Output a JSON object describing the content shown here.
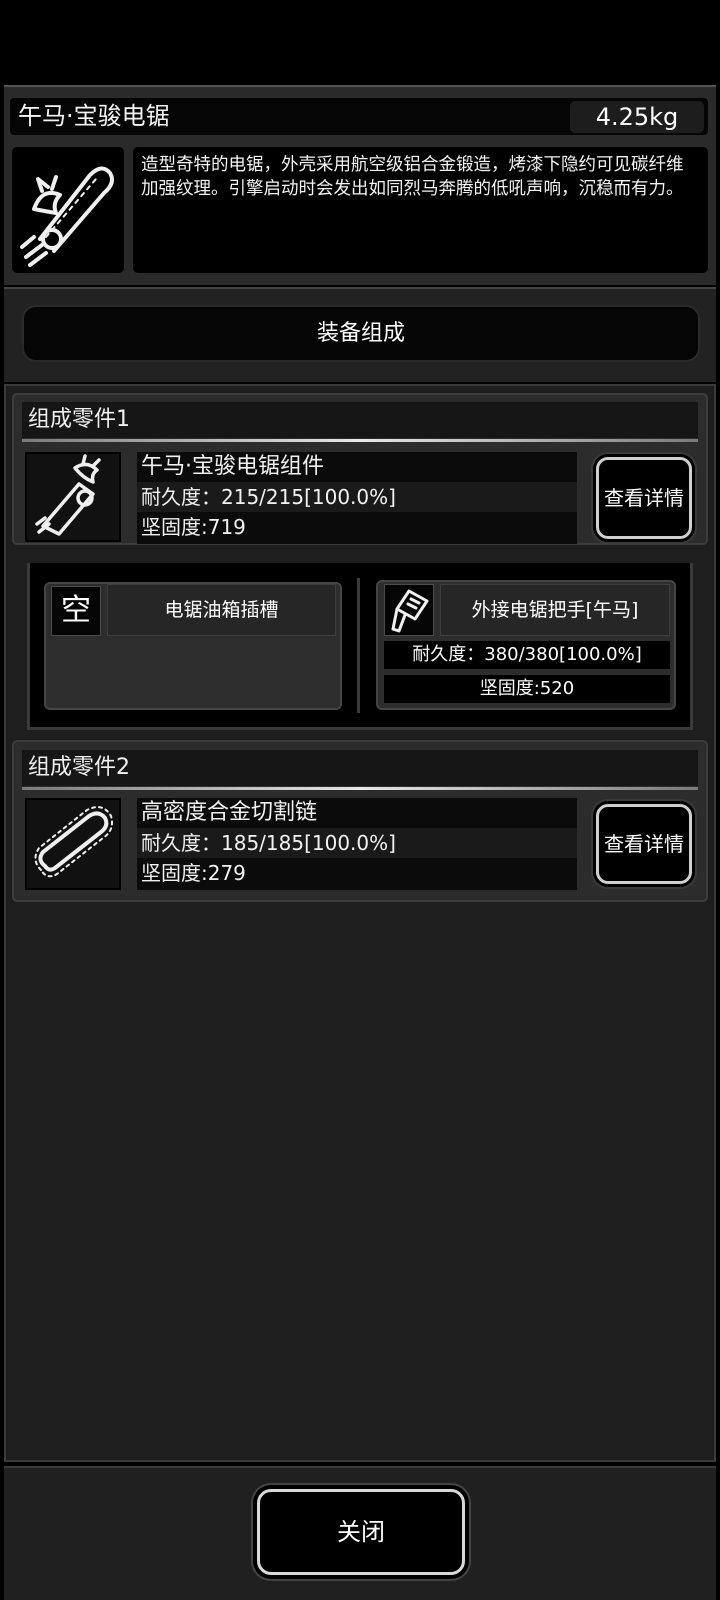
{
  "item": {
    "name": "午马·宝骏电锯",
    "weight": "4.25kg",
    "description": "造型奇特的电锯，外壳采用航空级铝合金锻造，烤漆下隐约可见碳纤维加强纹理。引擎启动时会发出如同烈马奔腾的低吼声响，沉稳而有力。",
    "icon": "horse-chainsaw-icon"
  },
  "compose_bar": {
    "label": "装备组成"
  },
  "parts": [
    {
      "header": "组成零件1",
      "name": "午马·宝骏电锯组件",
      "durability": "耐久度：215/215[100.0%]",
      "hardness": "坚固度:719",
      "detail_label": "查看详情",
      "icon": "horse-chainsaw-body-icon"
    },
    {
      "header": "组成零件2",
      "name": "高密度合金切割链",
      "durability": "耐久度：185/185[100.0%]",
      "hardness": "坚固度:279",
      "detail_label": "查看详情",
      "icon": "chainsaw-chain-icon"
    }
  ],
  "slots": {
    "empty_slot": {
      "marker": "空",
      "name": "电锯油箱插槽"
    },
    "handle_slot": {
      "name": "外接电锯把手[午马]",
      "durability": "耐久度：380/380[100.0%]",
      "hardness": "坚固度:520",
      "icon": "handle-icon"
    }
  },
  "footer": {
    "close_label": "关闭"
  }
}
